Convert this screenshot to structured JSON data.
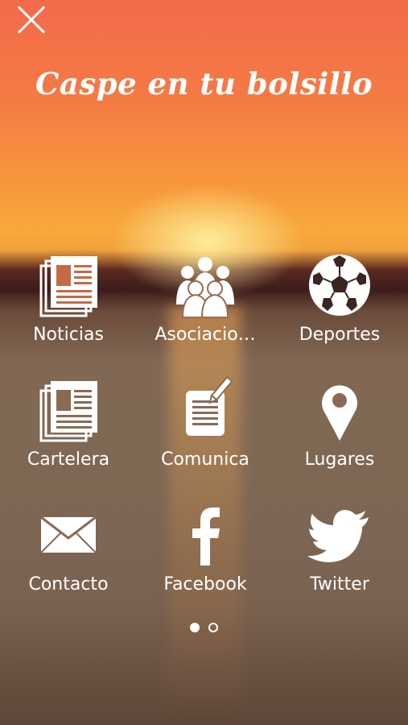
{
  "app": {
    "title": "Caspe en tu bolsillo"
  },
  "menu": {
    "items": [
      {
        "label": "Noticias",
        "icon": "newspaper-icon"
      },
      {
        "label": "Asociacio…",
        "icon": "group-icon"
      },
      {
        "label": "Deportes",
        "icon": "soccer-ball-icon"
      },
      {
        "label": "Cartelera",
        "icon": "newspaper-icon"
      },
      {
        "label": "Comunica",
        "icon": "note-pencil-icon"
      },
      {
        "label": "Lugares",
        "icon": "map-pin-icon"
      },
      {
        "label": "Contacto",
        "icon": "envelope-icon"
      },
      {
        "label": "Facebook",
        "icon": "facebook-icon"
      },
      {
        "label": "Twitter",
        "icon": "twitter-bird-icon"
      }
    ]
  },
  "pager": {
    "pages": 2,
    "current": 1
  },
  "colors": {
    "sky_top": "#f36a4a",
    "sky_mid": "#f7a93a",
    "water": "#7e6854",
    "foreground": "#ffffff"
  }
}
